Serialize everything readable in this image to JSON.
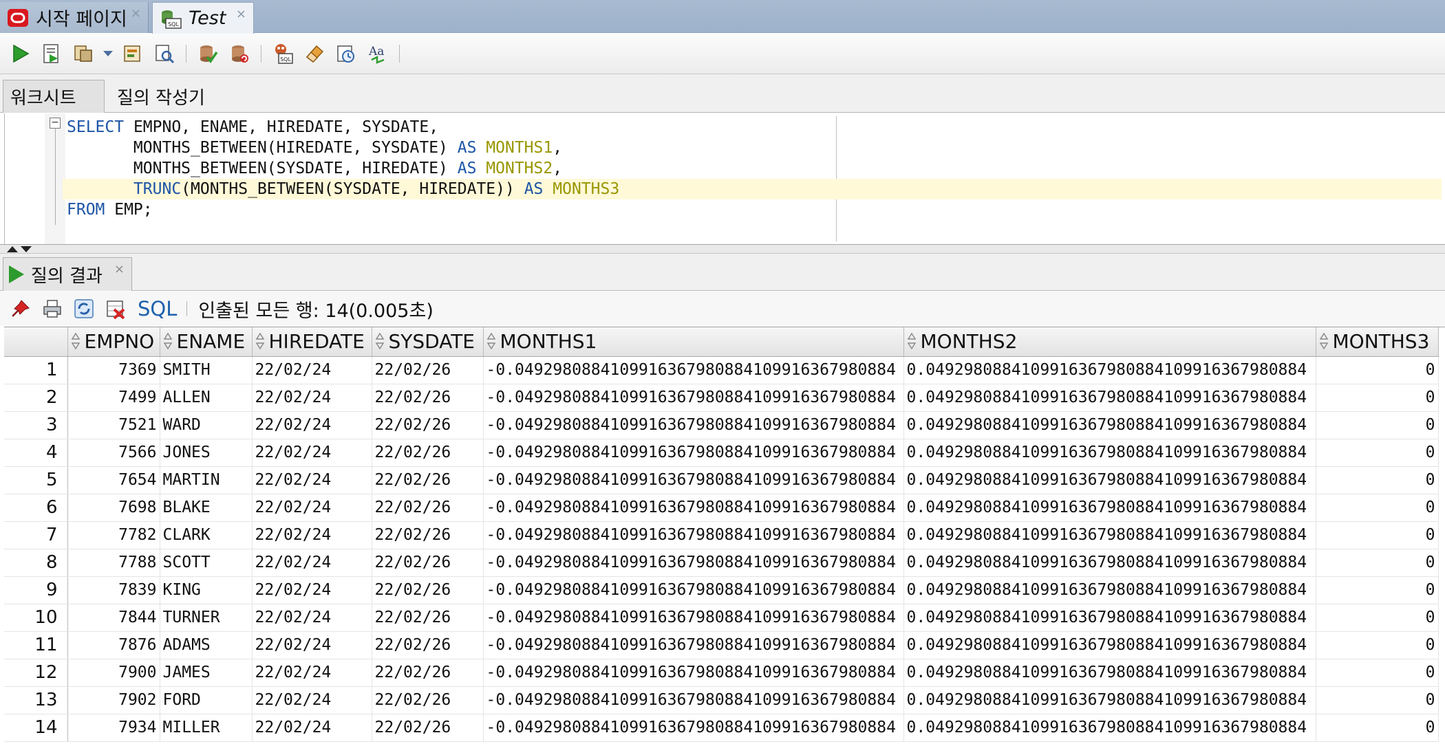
{
  "doc_tabs": [
    {
      "label": "시작 페이지",
      "icon": "oracle-logo-icon",
      "close": "×"
    },
    {
      "label": "Test",
      "icon": "sql-worksheet-icon",
      "close": "×"
    }
  ],
  "toolbar": {
    "icons": [
      "run-statement-icon",
      "run-script-icon",
      "autotrace-icon",
      "explain-plan-icon",
      "sql-tuning-icon",
      "commit-icon",
      "rollback-icon",
      "unshared-sql-icon",
      "clear-icon",
      "history-icon",
      "format-icon"
    ]
  },
  "worksheet_tabs": [
    "워크시트",
    "질의 작성기"
  ],
  "editor": {
    "lines": [
      [
        {
          "t": "SELECT",
          "c": "kw"
        },
        {
          "t": " EMPNO, ENAME, HIREDATE, SYSDATE,",
          "c": ""
        }
      ],
      [
        {
          "t": "       MONTHS_BETWEEN(HIREDATE, SYSDATE) ",
          "c": ""
        },
        {
          "t": "AS",
          "c": "kw"
        },
        {
          "t": " ",
          "c": ""
        },
        {
          "t": "MONTHS1",
          "c": "al"
        },
        {
          "t": ",",
          "c": ""
        }
      ],
      [
        {
          "t": "       MONTHS_BETWEEN(SYSDATE, HIREDATE) ",
          "c": ""
        },
        {
          "t": "AS",
          "c": "kw"
        },
        {
          "t": " ",
          "c": ""
        },
        {
          "t": "MONTHS2",
          "c": "al"
        },
        {
          "t": ",",
          "c": ""
        }
      ],
      [
        {
          "t": "       ",
          "c": ""
        },
        {
          "t": "TRUNC",
          "c": "kw"
        },
        {
          "t": "(MONTHS_BETWEEN(SYSDATE, HIREDATE)) ",
          "c": ""
        },
        {
          "t": "AS",
          "c": "kw"
        },
        {
          "t": " ",
          "c": ""
        },
        {
          "t": "MONTHS3",
          "c": "al"
        }
      ],
      [
        {
          "t": "FROM",
          "c": "kw"
        },
        {
          "t": " EMP;",
          "c": ""
        }
      ]
    ]
  },
  "results": {
    "tab_label": "질의 결과",
    "tab_close": "×",
    "sql_label": "SQL",
    "status": "인출된 모든 행: 14(0.005초)",
    "columns": [
      "EMPNO",
      "ENAME",
      "HIREDATE",
      "SYSDATE",
      "MONTHS1",
      "MONTHS2",
      "MONTHS3"
    ],
    "rows": [
      [
        "1",
        "7369",
        "SMITH",
        "22/02/24",
        "22/02/26",
        "-0.0492980884109916367980884109916367980884",
        "0.0492980884109916367980884109916367980884",
        "0"
      ],
      [
        "2",
        "7499",
        "ALLEN",
        "22/02/24",
        "22/02/26",
        "-0.0492980884109916367980884109916367980884",
        "0.0492980884109916367980884109916367980884",
        "0"
      ],
      [
        "3",
        "7521",
        "WARD",
        "22/02/24",
        "22/02/26",
        "-0.0492980884109916367980884109916367980884",
        "0.0492980884109916367980884109916367980884",
        "0"
      ],
      [
        "4",
        "7566",
        "JONES",
        "22/02/24",
        "22/02/26",
        "-0.0492980884109916367980884109916367980884",
        "0.0492980884109916367980884109916367980884",
        "0"
      ],
      [
        "5",
        "7654",
        "MARTIN",
        "22/02/24",
        "22/02/26",
        "-0.0492980884109916367980884109916367980884",
        "0.0492980884109916367980884109916367980884",
        "0"
      ],
      [
        "6",
        "7698",
        "BLAKE",
        "22/02/24",
        "22/02/26",
        "-0.0492980884109916367980884109916367980884",
        "0.0492980884109916367980884109916367980884",
        "0"
      ],
      [
        "7",
        "7782",
        "CLARK",
        "22/02/24",
        "22/02/26",
        "-0.0492980884109916367980884109916367980884",
        "0.0492980884109916367980884109916367980884",
        "0"
      ],
      [
        "8",
        "7788",
        "SCOTT",
        "22/02/24",
        "22/02/26",
        "-0.0492980884109916367980884109916367980884",
        "0.0492980884109916367980884109916367980884",
        "0"
      ],
      [
        "9",
        "7839",
        "KING",
        "22/02/24",
        "22/02/26",
        "-0.0492980884109916367980884109916367980884",
        "0.0492980884109916367980884109916367980884",
        "0"
      ],
      [
        "10",
        "7844",
        "TURNER",
        "22/02/24",
        "22/02/26",
        "-0.0492980884109916367980884109916367980884",
        "0.0492980884109916367980884109916367980884",
        "0"
      ],
      [
        "11",
        "7876",
        "ADAMS",
        "22/02/24",
        "22/02/26",
        "-0.0492980884109916367980884109916367980884",
        "0.0492980884109916367980884109916367980884",
        "0"
      ],
      [
        "12",
        "7900",
        "JAMES",
        "22/02/24",
        "22/02/26",
        "-0.0492980884109916367980884109916367980884",
        "0.0492980884109916367980884109916367980884",
        "0"
      ],
      [
        "13",
        "7902",
        "FORD",
        "22/02/24",
        "22/02/26",
        "-0.0492980884109916367980884109916367980884",
        "0.0492980884109916367980884109916367980884",
        "0"
      ],
      [
        "14",
        "7934",
        "MILLER",
        "22/02/24",
        "22/02/26",
        "-0.0492980884109916367980884109916367980884",
        "0.0492980884109916367980884109916367980884",
        "0"
      ]
    ]
  }
}
